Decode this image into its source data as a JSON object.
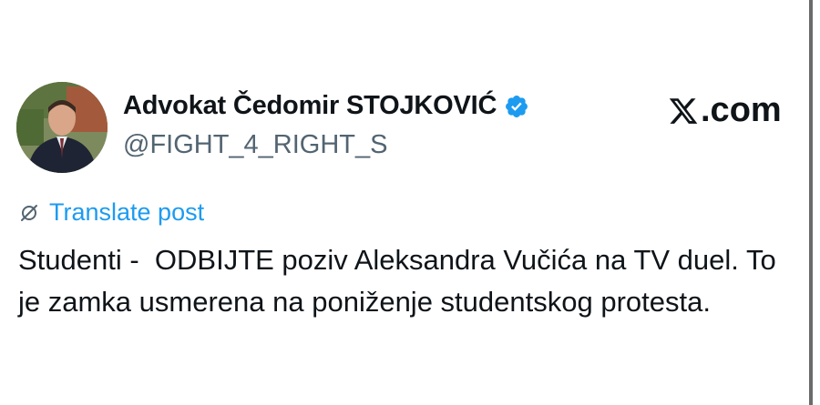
{
  "author": {
    "display_name": "Advokat Čedomir STOJKOVIĆ",
    "handle": "@FIGHT_4_RIGHT_S",
    "verified": true
  },
  "brand": {
    "label": ".com",
    "icon": "x-logo-icon"
  },
  "translate": {
    "label": "Translate post",
    "icon": "translate-icon"
  },
  "post": {
    "text": "Studenti -  ODBIJTE poziv Aleksandra Vučića na TV duel. To je zamka usmerena na poniženje studentskog protesta."
  },
  "colors": {
    "accent": "#1d9bf0",
    "text": "#0f1419",
    "muted": "#536471"
  }
}
